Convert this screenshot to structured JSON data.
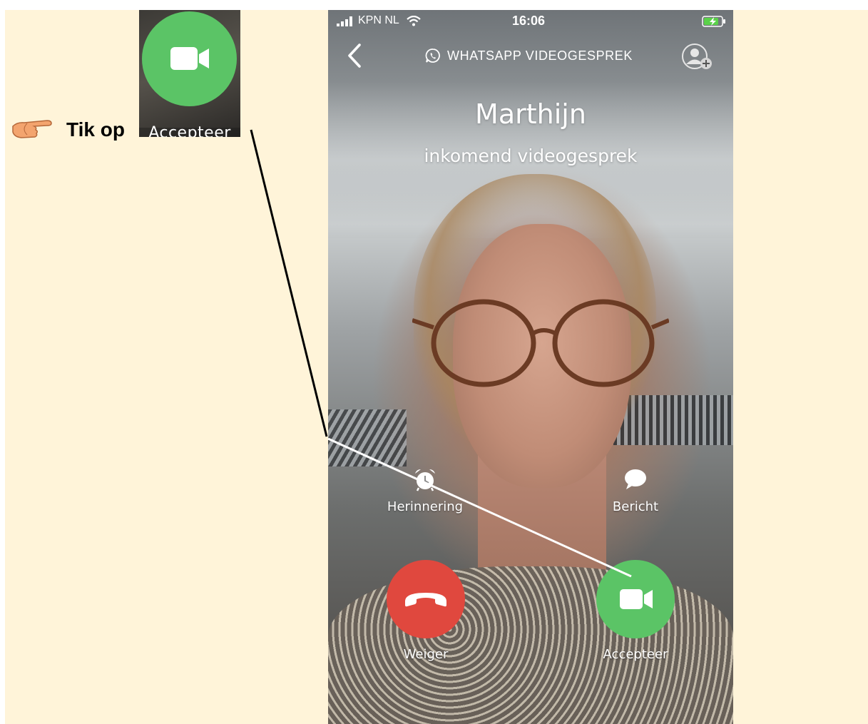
{
  "instruction": {
    "text": "Tik op",
    "hand_icon": "pointing-hand-icon",
    "thumbnail_label": "Accepteer"
  },
  "status_bar": {
    "carrier": "KPN NL",
    "time": "16:06",
    "signal_icon": "cellular-signal-icon",
    "wifi_icon": "wifi-icon",
    "battery_icon": "battery-charging-icon"
  },
  "header": {
    "back_icon": "chevron-left-icon",
    "app_icon": "whatsapp-icon",
    "title": "WHATSAPP VIDEOGESPREK",
    "add_icon": "add-participant-icon"
  },
  "call": {
    "caller_name": "Marthijn",
    "status": "inkomend videogesprek"
  },
  "actions": {
    "reminder_label": "Herinnering",
    "message_label": "Bericht",
    "decline_label": "Weiger",
    "accept_label": "Accepteer"
  },
  "colors": {
    "panel_background": "#fff4d9",
    "accept_green": "#5bc466",
    "decline_red": "#e0483e"
  }
}
